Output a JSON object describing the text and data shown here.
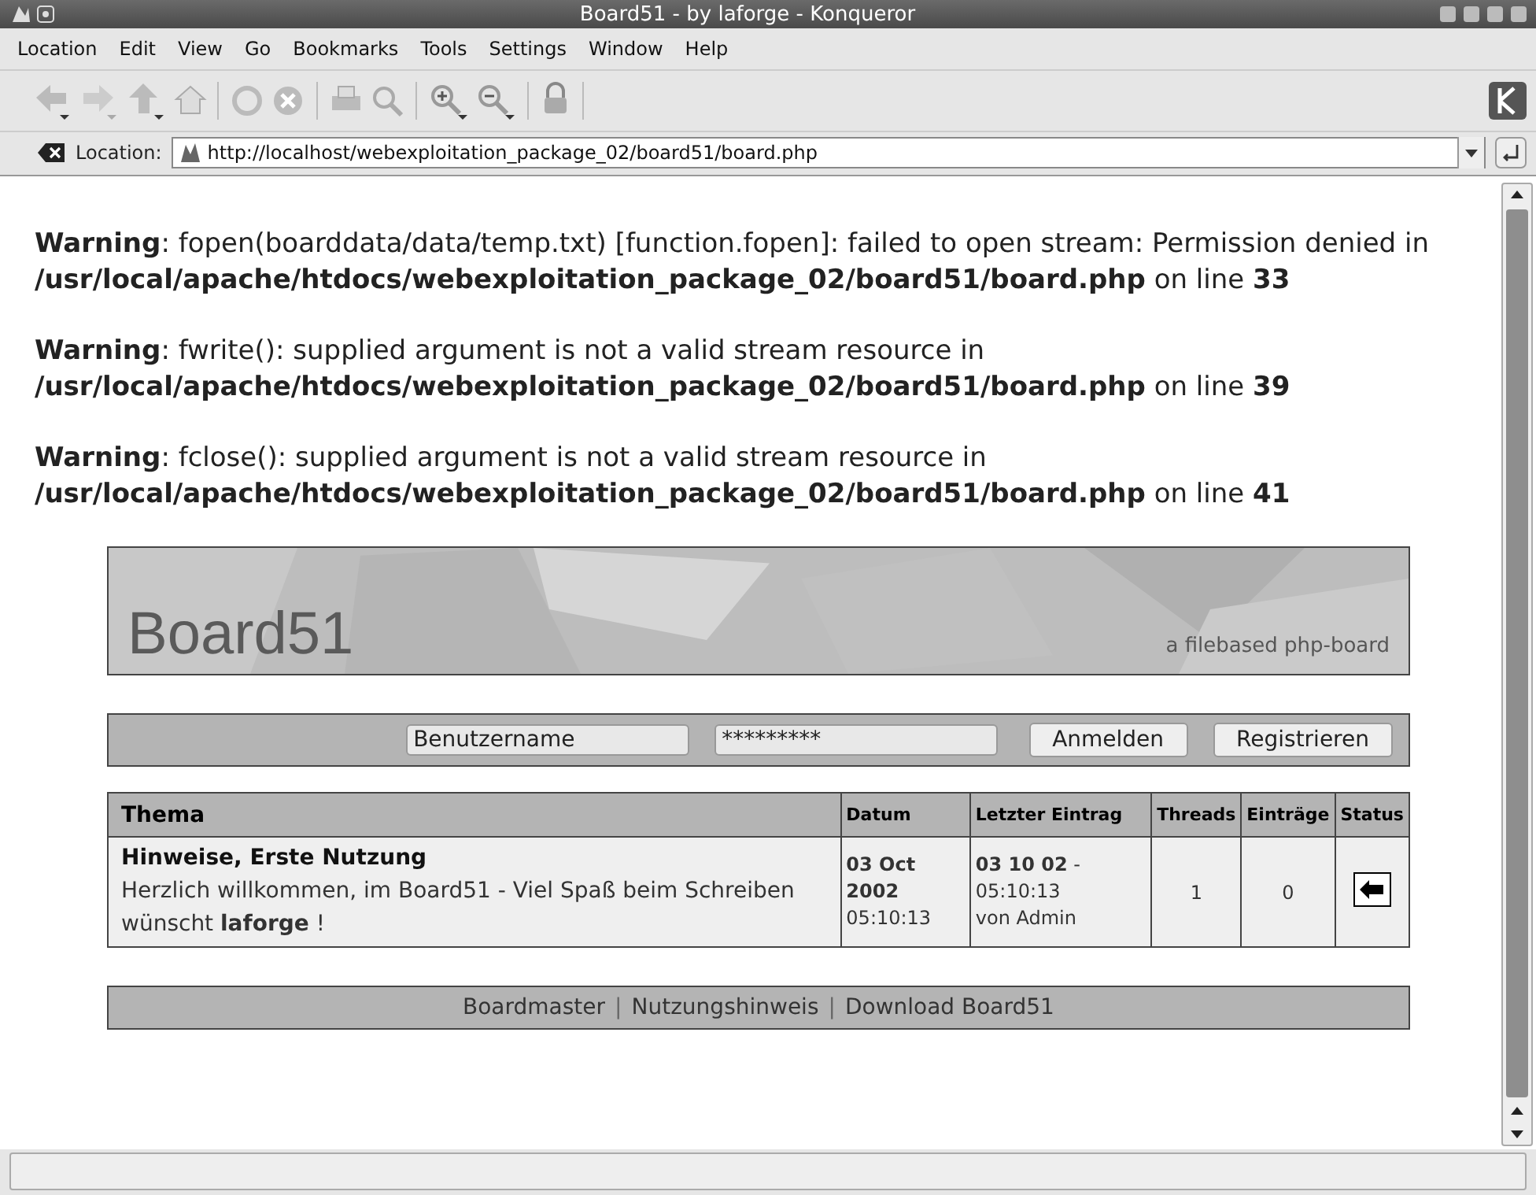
{
  "window": {
    "title": "Board51 - by laforge - Konqueror"
  },
  "menu": [
    "Location",
    "Edit",
    "View",
    "Go",
    "Bookmarks",
    "Tools",
    "Settings",
    "Window",
    "Help"
  ],
  "location": {
    "label": "Location:",
    "url": "http://localhost/webexploitation_package_02/board51/board.php"
  },
  "warnings": [
    "**Warning**: fopen(boarddata/data/temp.txt) [function.fopen]: failed to open stream: Permission denied in **/usr/local/apache/htdocs/webexploitation_package_02/board51/board.php** on line **33**",
    "**Warning**: fwrite(): supplied argument is not a valid stream resource in **/usr/local/apache/htdocs/webexploitation_package_02/board51/board.php** on line **39**",
    "**Warning**: fclose(): supplied argument is not a valid stream resource in **/usr/local/apache/htdocs/webexploitation_package_02/board51/board.php** on line **41**"
  ],
  "banner": {
    "title": "Board51",
    "subtitle": "a filebased php-board"
  },
  "login": {
    "username": "Benutzername",
    "password": "*********",
    "buttons": [
      "Anmelden",
      "Registrieren"
    ]
  },
  "table": {
    "columns": [
      "Thema",
      "Datum",
      "Letzter Eintrag",
      "Threads",
      "Einträge",
      "Status"
    ],
    "rows": [
      {
        "title": "Hinweise, Erste Nutzung",
        "description": "Herzlich willkommen, im Board51 - Viel Spaß beim Schreiben wünscht **laforge** !",
        "date": "03 Oct 2002",
        "time": "05:10:13",
        "last_entry": "**03 10 02** - 05:10:13",
        "last_author": "von Admin",
        "threads": "1",
        "entries": "0"
      }
    ]
  },
  "footer": {
    "links": [
      "Boardmaster",
      "Nutzungshinweis",
      "Download Board51"
    ],
    "separator": "|"
  }
}
